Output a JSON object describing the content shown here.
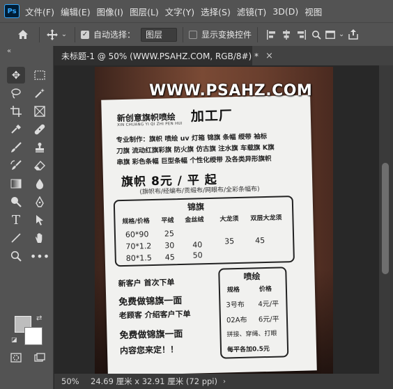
{
  "app": {
    "logo": "Ps"
  },
  "menu": [
    "文件(F)",
    "编辑(E)",
    "图像(I)",
    "图层(L)",
    "文字(Y)",
    "选择(S)",
    "滤镜(T)",
    "3D(D)",
    "视图"
  ],
  "options": {
    "home_icon": "home-icon",
    "move_icon": "move-icon",
    "auto_select_label": "自动选择：",
    "auto_select_checked": true,
    "auto_select_target": "图层",
    "show_transform_label": "显示变换控件",
    "show_transform_checked": false
  },
  "toolbar": {
    "collapse": "«",
    "tools": [
      "move-tool-icon",
      "marquee-tool-icon",
      "lasso-tool-icon",
      "magic-wand-tool-icon",
      "crop-tool-icon",
      "frame-tool-icon",
      "eyedropper-tool-icon",
      "healing-brush-tool-icon",
      "brush-tool-icon",
      "clone-stamp-tool-icon",
      "history-brush-tool-icon",
      "eraser-tool-icon",
      "gradient-tool-icon",
      "blur-tool-icon",
      "dodge-tool-icon",
      "pen-tool-icon",
      "type-tool-icon",
      "path-selection-tool-icon",
      "line-tool-icon",
      "hand-tool-icon",
      "zoom-tool-icon",
      "more-tools-icon",
      "quick-mask-icon",
      "screen-mode-icon"
    ],
    "foreground_color": "#bdbdbd",
    "background_color": "#ffffff"
  },
  "document": {
    "tab_title": "未标题-1 @ 50% (WWW.PSAHZ.COM, RGB/8#) *",
    "tab_close": "×"
  },
  "canvas": {
    "watermark": "WWW.PSAHZ.COM",
    "poster": {
      "title_small": "新创意旗帜喷绘",
      "pinyin": "XIN CHUANG YI QI ZHI PEN HUI",
      "title_big": "加工厂",
      "line1": "专业制作：旗帜 喷绘 uv 灯箱 锦旗 条幅 绶带 袖标",
      "line2": "刀旗 流动红旗彩旗 防火旗 仿古旗 注水旗 车载旗 K旗",
      "line3": "串旗 彩色条幅 巨型条幅 个性化绶带 及各类异形旗帜",
      "price": "旗帜 8元 / 平 起",
      "price_sub": "(旗帜布/经编布/贡缎布/网眼布/全彩条幅布)",
      "pennant": {
        "title": "锦旗",
        "headers": [
          "规格/价格",
          "平绒",
          "金丝绒",
          "大龙须",
          "双层大龙须"
        ],
        "rows": [
          [
            "60*90",
            "25",
            "",
            "",
            ""
          ],
          [
            "70*1.2",
            "30",
            "40",
            "35",
            "45"
          ],
          [
            "80*1.5",
            "45",
            "50",
            "",
            ""
          ]
        ]
      },
      "left_cta": {
        "line1": "新客户 首次下单",
        "line2": "免费做锦旗一面",
        "line3": "老顾客 介绍客户下单",
        "line4": "免费做锦旗一面",
        "line5": "内容您来定！！"
      },
      "spray": {
        "title": "喷绘",
        "headers": [
          "规格",
          "价格"
        ],
        "rows": [
          [
            "3号布",
            "4元/平"
          ],
          [
            "02A布",
            "6元/平"
          ]
        ],
        "note1": "拼接、穿绳、打眼",
        "note2": "每平各加0.5元"
      }
    }
  },
  "status": {
    "zoom": "50%",
    "doc_size": "24.69 厘米 x 32.91 厘米 (72 ppi)",
    "arrow": "›"
  }
}
